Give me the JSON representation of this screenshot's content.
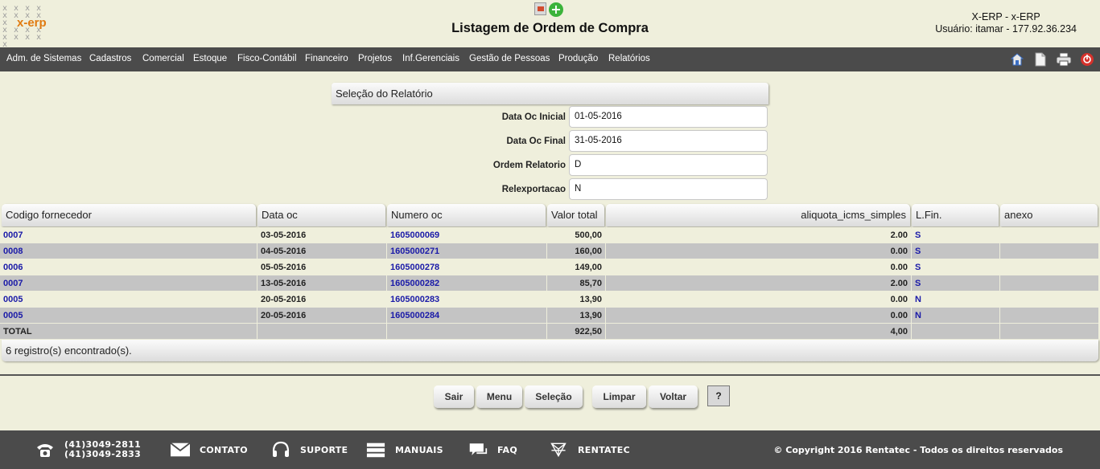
{
  "header": {
    "logo_text": "x-erp",
    "title": "Listagem de Ordem de Compra",
    "system": "X-ERP - x-ERP",
    "user": "Usuário: itamar - 177.92.36.234"
  },
  "nav": {
    "items": [
      {
        "label": "Adm. de Sistemas"
      },
      {
        "label": "Cadastros"
      },
      {
        "label": "Comercial"
      },
      {
        "label": "Estoque"
      },
      {
        "label": "Fisco-Contábil"
      },
      {
        "label": "Financeiro"
      },
      {
        "label": "Projetos"
      },
      {
        "label": "Inf.Gerenciais"
      },
      {
        "label": "Gestão de Pessoas"
      },
      {
        "label": "Produção"
      },
      {
        "label": "Relatórios"
      }
    ],
    "tools": [
      "home-icon",
      "document-icon",
      "print-icon",
      "logout-icon"
    ]
  },
  "selection": {
    "title": "Seleção do Relatório",
    "fields": [
      {
        "label": "Data Oc Inicial",
        "value": "01-05-2016"
      },
      {
        "label": "Data Oc Final",
        "value": "31-05-2016"
      },
      {
        "label": "Ordem Relatorio",
        "value": "D"
      },
      {
        "label": "Relexportacao",
        "value": "N"
      }
    ]
  },
  "table": {
    "columns": [
      "Codigo fornecedor",
      "Data oc",
      "Numero oc",
      "Valor total",
      "aliquota_icms_simples",
      "L.Fin.",
      "anexo"
    ],
    "rows": [
      {
        "fornecedor": "0007",
        "data": "03-05-2016",
        "numero": "1605000069",
        "valor": "500,00",
        "aliquota": "2.00",
        "lfin": "S",
        "anexo": ""
      },
      {
        "fornecedor": "0008",
        "data": "04-05-2016",
        "numero": "1605000271",
        "valor": "160,00",
        "aliquota": "0.00",
        "lfin": "S",
        "anexo": ""
      },
      {
        "fornecedor": "0006",
        "data": "05-05-2016",
        "numero": "1605000278",
        "valor": "149,00",
        "aliquota": "0.00",
        "lfin": "S",
        "anexo": ""
      },
      {
        "fornecedor": "0007",
        "data": "13-05-2016",
        "numero": "1605000282",
        "valor": "85,70",
        "aliquota": "2.00",
        "lfin": "S",
        "anexo": ""
      },
      {
        "fornecedor": "0005",
        "data": "20-05-2016",
        "numero": "1605000283",
        "valor": "13,90",
        "aliquota": "0.00",
        "lfin": "N",
        "anexo": ""
      },
      {
        "fornecedor": "0005",
        "data": "20-05-2016",
        "numero": "1605000284",
        "valor": "13,90",
        "aliquota": "0.00",
        "lfin": "N",
        "anexo": ""
      }
    ],
    "total": {
      "label": "TOTAL",
      "valor": "922,50",
      "aliquota": "4,00"
    },
    "result_text": "6 registro(s) encontrado(s)."
  },
  "buttons": {
    "sair": "Sair",
    "menu": "Menu",
    "selecao": "Seleção",
    "limpar": "Limpar",
    "voltar": "Voltar",
    "help": "?"
  },
  "footer": {
    "phone1": "(41)3049-2811",
    "phone2": "(41)3049-2833",
    "contato": "CONTATO",
    "suporte": "SUPORTE",
    "manuais": "MANUAIS",
    "faq": "FAQ",
    "rentatec": "RENTATEC",
    "copyright": "© Copyright 2016 Rentatec - Todos os direitos reservados"
  },
  "colors": {
    "background": "#efefdc",
    "nav_bg": "#4b4b4b",
    "link": "#1a1aa8",
    "row_alt": "#c4c4c4"
  }
}
